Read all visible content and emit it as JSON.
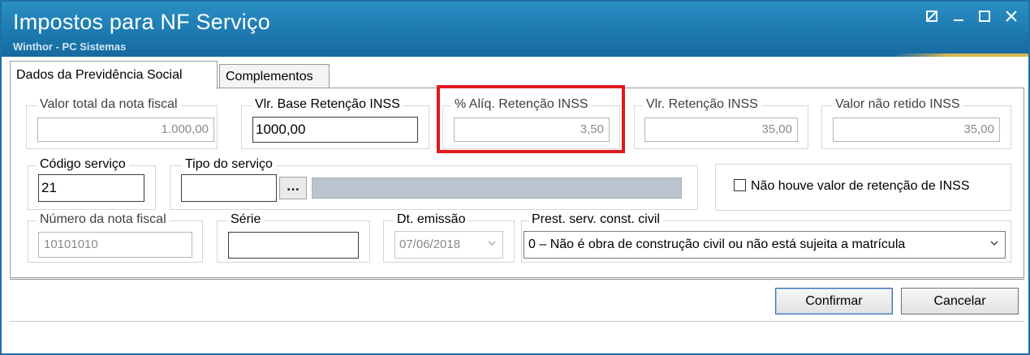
{
  "window": {
    "title": "Impostos para NF Serviço",
    "subtitle": "Winthor - PC Sistemas",
    "buttons": {
      "restore_icon": "restore-icon",
      "minimize_icon": "minimize-icon",
      "maximize_icon": "maximize-icon",
      "close_icon": "close-icon"
    }
  },
  "tabs": [
    {
      "label": "Dados da Previdência Social",
      "active": true
    },
    {
      "label": "Complementos",
      "active": false
    }
  ],
  "fields": {
    "valor_total": {
      "label": "Valor total da nota fiscal",
      "value": "1.000,00"
    },
    "vlr_base": {
      "label": "Vlr. Base Retenção INSS",
      "value": "1000,00"
    },
    "aliq": {
      "label": "% Alíq. Retenção INSS",
      "value": "3,50"
    },
    "vlr_retencao": {
      "label": "Vlr. Retenção INSS",
      "value": "35,00"
    },
    "valor_nao_retido": {
      "label": "Valor não retido INSS",
      "value": "35,00"
    },
    "codigo_servico": {
      "label": "Código serviço",
      "value": "21"
    },
    "tipo_servico": {
      "label": "Tipo do serviço",
      "value": "",
      "browse_label": "..."
    },
    "nao_houve": {
      "label": "Não houve valor de retenção de INSS",
      "checked": false
    },
    "numero_nf": {
      "label": "Número da nota fiscal",
      "value": "10101010"
    },
    "serie": {
      "label": "Série",
      "value": ""
    },
    "dt_emissao": {
      "label": "Dt. emissão",
      "value": "07/06/2018"
    },
    "prest_serv": {
      "label": "Prest. serv. const. civil",
      "value": "0 – Não é obra de construção civil ou não está sujeita a matrícula"
    }
  },
  "buttons": {
    "confirmar": "Confirmar",
    "cancelar": "Cancelar"
  },
  "colors": {
    "titlebar": "#1d7ab0",
    "highlight": "#e0191d"
  }
}
